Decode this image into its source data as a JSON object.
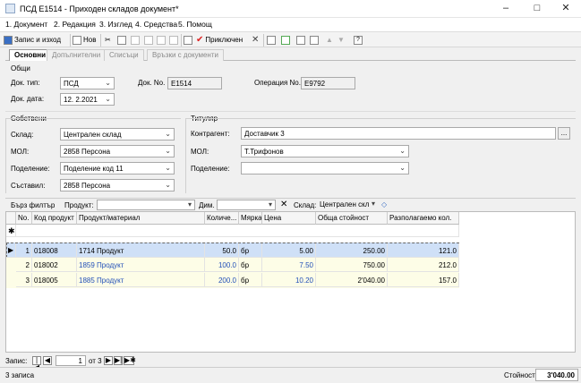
{
  "window": {
    "title": "ПСД E1514 - Приходен складов документ*"
  },
  "menu": [
    "1. Документ",
    "2. Редакция",
    "3. Изглед",
    "4. Средства",
    "5. Помощ"
  ],
  "toolbar": {
    "save_label": "Запис и изход",
    "new_label": "Нов",
    "confirm_label": "Приключен"
  },
  "tabs": [
    "Основни",
    "Допълнителни",
    "Списъци",
    "Връзки с документи"
  ],
  "general": {
    "section": "Общи",
    "doc_type_label": "Док. тип:",
    "doc_type": "ПСД",
    "doc_no_label": "Док. No.",
    "doc_no": "E1514",
    "op_no_label": "Операция No.",
    "op_no": "E9792",
    "doc_date_label": "Док. дата:",
    "doc_date": "12. 2.2021"
  },
  "own": {
    "section": "Собствени",
    "warehouse_label": "Склад:",
    "warehouse": "Централен склад",
    "mol_label": "МОЛ:",
    "mol": "2858 Персона",
    "division_label": "Поделение:",
    "division": "Поделение код 11",
    "author_label": "Съставил:",
    "author": "2858 Персона"
  },
  "holder": {
    "section": "Титуляр",
    "contractor_label": "Контрагент:",
    "contractor": "Доставчик 3",
    "mol_label": "МОЛ:",
    "mol": "Т.Трифонов",
    "division_label": "Поделение:",
    "division": ""
  },
  "filter": {
    "quick_label": "Бърз филтър",
    "product_label": "Продукт:",
    "product_value": "",
    "dim_label": "Дим.",
    "warehouse_label": "Склад:",
    "warehouse_value": "Централен скл"
  },
  "grid": {
    "headers": [
      "No.",
      "Код продукт",
      "Продукт/материал",
      "Количе...",
      "Мярка",
      "Цена",
      "Обща стойност",
      "Разполагаемо кол."
    ],
    "rows": [
      {
        "no": "1",
        "code": "018008",
        "name": "1714 Продукт",
        "qty": "50.0",
        "unit": "бр",
        "price": "5.00",
        "total": "250.00",
        "avail": "121.0"
      },
      {
        "no": "2",
        "code": "018002",
        "name": "1859 Продукт",
        "qty": "100.0",
        "unit": "бр",
        "price": "7.50",
        "total": "750.00",
        "avail": "212.0"
      },
      {
        "no": "3",
        "code": "018005",
        "name": "1885 Продукт",
        "qty": "200.0",
        "unit": "бр",
        "price": "10.20",
        "total": "2'040.00",
        "avail": "157.0"
      }
    ]
  },
  "nav": {
    "record_label": "Запис:",
    "current": "1",
    "of_label": "от 3"
  },
  "status": {
    "count": "3 записа",
    "value_label": "Стойност:",
    "value": "3'040.00"
  }
}
